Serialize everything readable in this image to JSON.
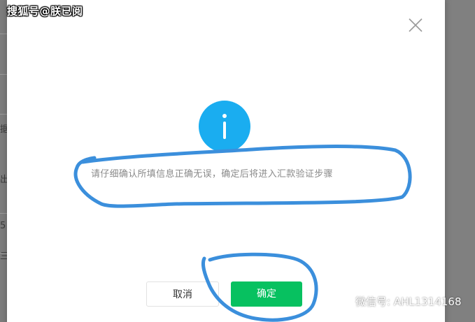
{
  "watermark_top": "搜狐号@朕已阅",
  "watermark_bottom": "微信号: AHL1314168",
  "dialog": {
    "message": "请仔细确认所填信息正确无误，确定后将进入汇款验证步骤",
    "cancel_label": "取消",
    "confirm_label": "确定"
  },
  "background_fragments": [
    "据",
    "出",
    "5",
    "三"
  ],
  "icons": {
    "close": "close-icon",
    "info": "info-icon",
    "wechat": "wechat-icon"
  },
  "colors": {
    "info_blue": "#1aadf0",
    "confirm_green": "#07c160",
    "annotation_blue": "#3b8fdc"
  }
}
